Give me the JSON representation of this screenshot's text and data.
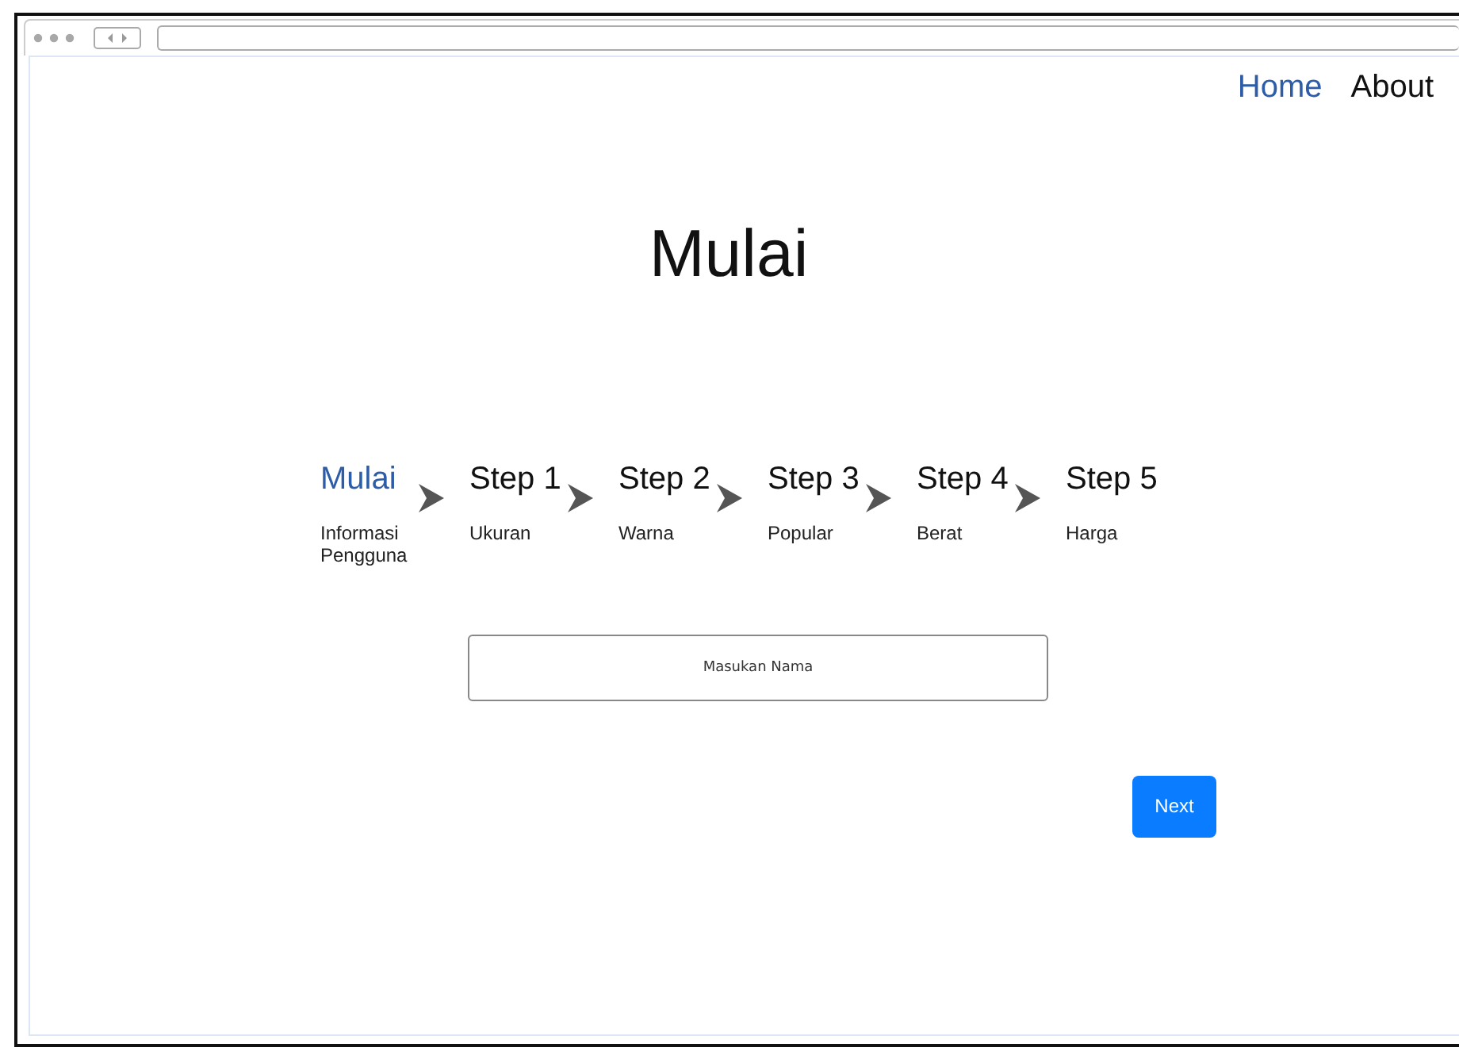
{
  "nav": [
    {
      "label": "Home",
      "selected": true
    },
    {
      "label": "About",
      "selected": false
    }
  ],
  "title": "Mulai",
  "steps": [
    {
      "label": "Mulai",
      "caption": "Informasi Pengguna",
      "selected": true
    },
    {
      "label": "Step 1",
      "caption": "Ukuran",
      "selected": false
    },
    {
      "label": "Step 2",
      "caption": "Warna",
      "selected": false
    },
    {
      "label": "Step 3",
      "caption": "Popular",
      "selected": false
    },
    {
      "label": "Step 4",
      "caption": "Berat",
      "selected": false
    },
    {
      "label": "Step 5",
      "caption": "Harga",
      "selected": false
    }
  ],
  "name_field": {
    "placeholder": "Masukan Nama"
  },
  "buttons": [
    "Next"
  ]
}
